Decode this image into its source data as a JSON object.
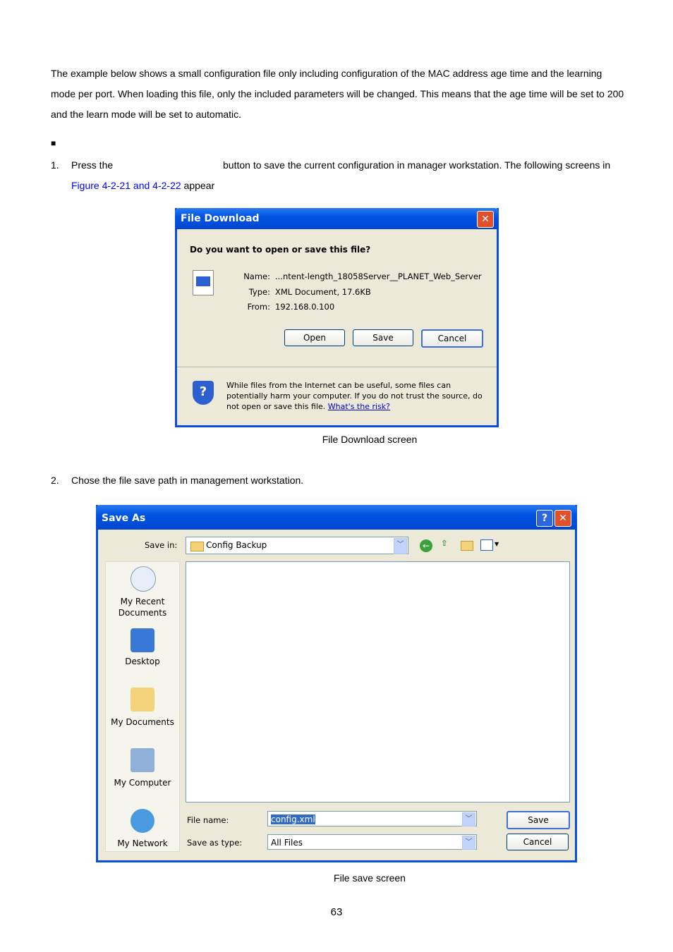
{
  "intro": "The example below shows a small configuration file only including configuration of the MAC address age time and the learning mode per port. When loading this file, only the included parameters will be changed. This means that the age time will be set to 200 and the learn mode will be set to automatic.",
  "bullet": "■",
  "step1": {
    "num": "1.",
    "pre": "Press the",
    "post": "button to save the current configuration in manager workstation. The following screens in",
    "link": "Figure 4-2-21 and 4-2-22",
    "tail": " appear"
  },
  "download": {
    "title": "File Download",
    "question": "Do you want to open or save this file?",
    "name_label": "Name:",
    "name": "...ntent-length_18058Server__PLANET_Web_Server",
    "type_label": "Type:",
    "type": "XML Document, 17.6KB",
    "from_label": "From:",
    "from": "192.168.0.100",
    "open": "Open",
    "save": "Save",
    "cancel": "Cancel",
    "warning": "While files from the Internet can be useful, some files can potentially harm your computer. If you do not trust the source, do not open or save this file.",
    "risk_link": "What's the risk?",
    "close": "✕"
  },
  "caption1": "File Download screen",
  "step2": {
    "num": "2.",
    "text": "Chose the file save path in management workstation."
  },
  "saveas": {
    "title": "Save As",
    "help": "?",
    "close": "✕",
    "save_in_label": "Save in:",
    "save_in": "Config Backup",
    "places": [
      "My Recent Documents",
      "Desktop",
      "My Documents",
      "My Computer",
      "My Network"
    ],
    "file_name_label": "File name:",
    "file_name": "config.xml",
    "type_label": "Save as type:",
    "type": "All Files",
    "save": "Save",
    "cancel": "Cancel"
  },
  "caption2": "File save screen",
  "page_number": "63"
}
